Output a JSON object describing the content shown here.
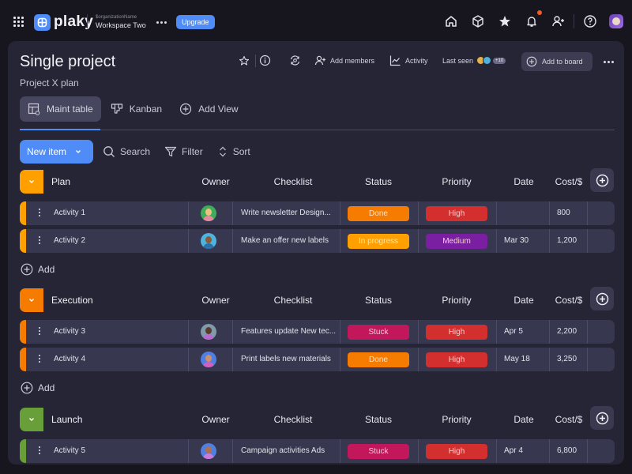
{
  "topbar": {
    "logo_text": "plaky",
    "organization_name": "$organizationName",
    "workspace_name": "Workspace Two",
    "upgrade_label": "Upgrade",
    "icons": [
      "home-icon",
      "cube-icon",
      "star-icon",
      "bell-icon",
      "add-user-icon",
      "help-icon"
    ],
    "notification_dot_color": "#f05a28"
  },
  "project": {
    "title": "Single project",
    "subtitle": "Project X plan",
    "add_members_label": "Add members",
    "activity_label": "Activity",
    "last_seen_label": "Last seen",
    "last_seen_more": "+10",
    "add_to_board_label": "Add to board"
  },
  "tabs": [
    {
      "label": "Maint table",
      "active": true
    },
    {
      "label": "Kanban",
      "active": false
    },
    {
      "label": "Add View",
      "active": false
    }
  ],
  "toolbar": {
    "new_item_label": "New item",
    "search_label": "Search",
    "filter_label": "Filter",
    "sort_label": "Sort"
  },
  "columns": {
    "owner": "Owner",
    "checklist": "Checklist",
    "status": "Status",
    "priority": "Priority",
    "date": "Date",
    "cost": "Cost/$"
  },
  "add_label": "Add",
  "colors": {
    "accent": "#4f8cf7",
    "plan": "#ffa000",
    "execution": "#f57c00",
    "launch": "#689f38",
    "done": "#f57c00",
    "in_progress": "#ffa000",
    "stuck": "#c2185b",
    "high": "#d32f2f",
    "medium": "#7b1fa2"
  },
  "groups": [
    {
      "name": "Plan",
      "rows": [
        {
          "name": "Activity 1",
          "checklist": "Write newsletter Design...",
          "status": "Done",
          "priority": "High",
          "date": "",
          "cost": "800"
        },
        {
          "name": "Activity 2",
          "checklist": "Make an offer new labels",
          "status": "In progress",
          "priority": "Medium",
          "date": "Mar 30",
          "cost": "1,200"
        }
      ]
    },
    {
      "name": "Execution",
      "rows": [
        {
          "name": "Activity 3",
          "checklist": "Features update New tec...",
          "status": "Stuck",
          "priority": "High",
          "date": "Apr 5",
          "cost": "2,200"
        },
        {
          "name": "Activity 4",
          "checklist": "Print labels new materials",
          "status": "Done",
          "priority": "High",
          "date": "May 18",
          "cost": "3,250"
        }
      ]
    },
    {
      "name": "Launch",
      "rows": [
        {
          "name": "Activity 5",
          "checklist": "Campaign activities Ads",
          "status": "Stuck",
          "priority": "High",
          "date": "Apr 4",
          "cost": "6,800"
        }
      ]
    }
  ]
}
